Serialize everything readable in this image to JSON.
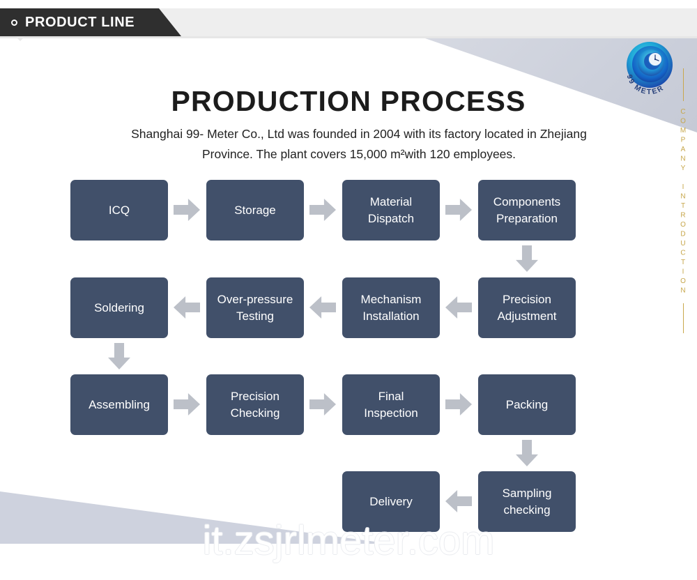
{
  "header": {
    "tab_label": "PRODUCT LINE",
    "tab_icon": "circle-outline-icon"
  },
  "brand": {
    "logo_name": "99-meter-logo",
    "logo_text": "99 METER",
    "vertical_label": "COMPANY INTRODUCTION"
  },
  "main": {
    "title": "PRODUCTION PROCESS",
    "description": "Shanghai 99- Meter Co., Ltd was founded in 2004 with its factory located in Zhejiang Province. The plant covers 15,000 m²with 120 employees."
  },
  "watermark": {
    "text": "it.zsjrlmeter.com"
  },
  "colors": {
    "node_fill": "#41506a",
    "arrow_fill": "#bcc0c8",
    "tab_background": "#2f2f2f",
    "topbar_background": "#eeeeee",
    "gold_accent": "#c6a64a",
    "wedge_fill": "#ced2de",
    "page_background": "#ffffff"
  },
  "flow": {
    "nodes": [
      {
        "id": "icq",
        "label": "ICQ",
        "row": 1
      },
      {
        "id": "storage",
        "label": "Storage",
        "row": 1
      },
      {
        "id": "material-dispatch",
        "label": "Material\nDispatch",
        "row": 1
      },
      {
        "id": "components-preparation",
        "label": "Components\nPreparation",
        "row": 1
      },
      {
        "id": "soldering",
        "label": "Soldering",
        "row": 2
      },
      {
        "id": "over-pressure-testing",
        "label": "Over-pressure\nTesting",
        "row": 2
      },
      {
        "id": "mechanism-installation",
        "label": "Mechanism\nInstallation",
        "row": 2
      },
      {
        "id": "precision-adjustment",
        "label": "Precision\nAdjustment",
        "row": 2
      },
      {
        "id": "assembling",
        "label": "Assembling",
        "row": 3
      },
      {
        "id": "precision-checking",
        "label": "Precision\nChecking",
        "row": 3
      },
      {
        "id": "final-inspection",
        "label": "Final\nInspection",
        "row": 3
      },
      {
        "id": "packing",
        "label": "Packing",
        "row": 3
      },
      {
        "id": "delivery",
        "label": "Delivery",
        "row": 4
      },
      {
        "id": "sampling-checking",
        "label": "Sampling\nchecking",
        "row": 4
      }
    ],
    "arrows": [
      {
        "id": "icq-to-storage",
        "direction": "right"
      },
      {
        "id": "storage-to-material-dispatch",
        "direction": "right"
      },
      {
        "id": "material-dispatch-to-components-preparation",
        "direction": "right"
      },
      {
        "id": "components-preparation-to-precision-adjustment",
        "direction": "down"
      },
      {
        "id": "precision-adjustment-to-mechanism-installation",
        "direction": "left"
      },
      {
        "id": "mechanism-installation-to-over-pressure-testing",
        "direction": "left"
      },
      {
        "id": "over-pressure-testing-to-soldering",
        "direction": "left"
      },
      {
        "id": "soldering-to-assembling",
        "direction": "down"
      },
      {
        "id": "assembling-to-precision-checking",
        "direction": "right"
      },
      {
        "id": "precision-checking-to-final-inspection",
        "direction": "right"
      },
      {
        "id": "final-inspection-to-packing",
        "direction": "right"
      },
      {
        "id": "packing-to-sampling-checking",
        "direction": "down"
      },
      {
        "id": "sampling-checking-to-delivery",
        "direction": "left"
      }
    ]
  }
}
